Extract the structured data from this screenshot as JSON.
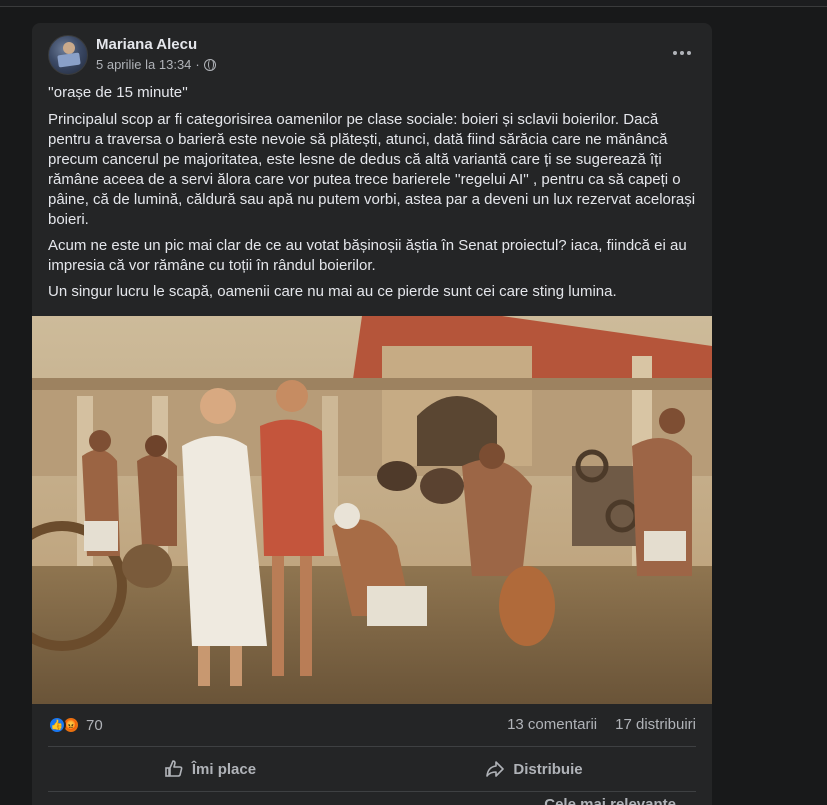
{
  "post": {
    "author": "Mariana Alecu",
    "timestamp": "5 aprilie la 13:34",
    "paragraphs": [
      "''orașe de 15 minute''",
      "Principalul scop ar fi categorisirea oamenilor pe clase sociale: boieri și sclavii boierilor.  Dacă pentru a traversa o barieră este nevoie să plătești, atunci, dată fiind sărăcia care ne mănâncă precum cancerul pe majoritatea,  este lesne de dedus că altă variantă care ți se sugerează îți rămâne aceea de a servi ălora care vor putea trece barierele ''regelui AI'' , pentru ca să capeți o pâine, că de lumină, căldură sau apă nu putem vorbi, astea par a deveni un lux rezervat acelorași boieri.",
      "Acum ne este un pic mai clar de ce au votat bășinoșii ăștia în Senat proiectul?  iaca, fiindcă ei au impresia că vor rămâne cu toții în rândul boierilor.",
      "Un singur lucru le scapă, oamenii care nu mai au ce pierde sunt cei care sting lumina."
    ]
  },
  "stats": {
    "reaction_count": "70",
    "comments": "13 comentarii",
    "shares": "17 distribuiri"
  },
  "actions": {
    "like": "Îmi place",
    "share": "Distribuie"
  },
  "sort_label": "Cele mai relevante",
  "icons": {
    "like": "thumbs-up-icon",
    "share": "share-arrow-icon",
    "privacy": "globe-icon",
    "menu": "more-options-icon",
    "react_like": "like-reaction-icon",
    "react_angry": "angry-reaction-icon"
  },
  "colors": {
    "background": "#18191a",
    "card": "#242526",
    "text": "#e4e6eb",
    "secondary": "#b0b3b8",
    "like_blue": "#1877f2",
    "angry_orange": "#e9710f"
  }
}
